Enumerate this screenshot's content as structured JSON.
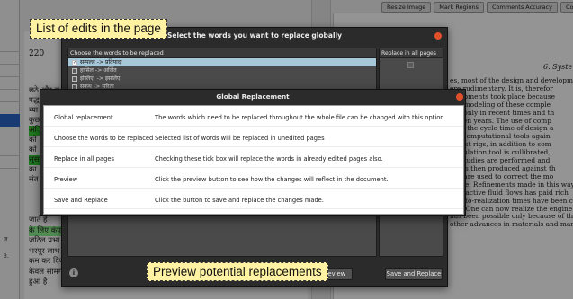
{
  "toolbar": {
    "buttons": [
      "Resize Image",
      "Mark Regions",
      "Comments Accuracy",
      "Comp"
    ]
  },
  "document": {
    "page_number": "220",
    "hindi_lines": [
      "छठे और स",
      "पद्ध",
      "व्या",
      "कुछ",
      "अंि",
      "को",
      "को",
      "सुस",
      "का",
      "संत"
    ],
    "hindi_bottom": [
      "जाते हैं।",
      "के लिए कंप्",
      "जटिल प्रभा",
      "भरपूर लाभ",
      "कम कर दिए",
      "केवल सामग्",
      "हुआ है।"
    ],
    "english_heading": "6. Syste",
    "english_lines": [
      "es, most of the design and development",
      "ere rudimentary. It is, therefor",
      "velopments took place because",
      "ical modeling of these comple",
      "rity only in recent times and th",
      "fifteen years. The use of comp",
      "both the cycle time of design a",
      "the computational tools again",
      "in test rigs, in addition to som",
      "calculation tool is cullibrated,",
      "ity studies are performed and",
      "are is then produced against th",
      "ons are used to correct the mo",
      "itable. Refinements made in this way",
      "of reactive fluid flows has paid rich",
      "tion-to-realization times have been cu",
      "des. One can now realize the engine f",
      "has been possible only because of the",
      "other advances in materials and man"
    ]
  },
  "select_dialog": {
    "title": "Select the words you want to replace globally",
    "list_header": "Choose the words to be replaced",
    "items": [
      {
        "text": "सम्पल्ल -> प्रतिपादा",
        "checked": true
      },
      {
        "text": "हासिल -> अर्जित",
        "checked": false
      },
      {
        "text": "इस्लिए, -> इसलिए,",
        "checked": false
      },
      {
        "text": "सकथ -> सरिता",
        "checked": false
      }
    ],
    "replace_header": "Replace in all pages",
    "preview_label": "Preview",
    "save_label": "Save and Replace",
    "help_glyph": "i"
  },
  "global_replacement": {
    "title": "Global Replacement",
    "rows": [
      {
        "key": "Global replacement",
        "value": "The words which need to be replaced throughout the whole file can be changed with this option."
      },
      {
        "key": "Choose the words to be replaced",
        "value": "Selected list of words will be replaced in unedited pages"
      },
      {
        "key": "Replace in all pages",
        "value": "Checking these tick box will replace the words in already edited pages also."
      },
      {
        "key": "Preview",
        "value": "Click the preview button to see how the changes will reflect in the document."
      },
      {
        "key": "Save and Replace",
        "value": "Click the button to save and replace the changes made."
      }
    ]
  },
  "annotations": {
    "top": "List of edits in the page",
    "bottom": "Preview potential replacements"
  }
}
